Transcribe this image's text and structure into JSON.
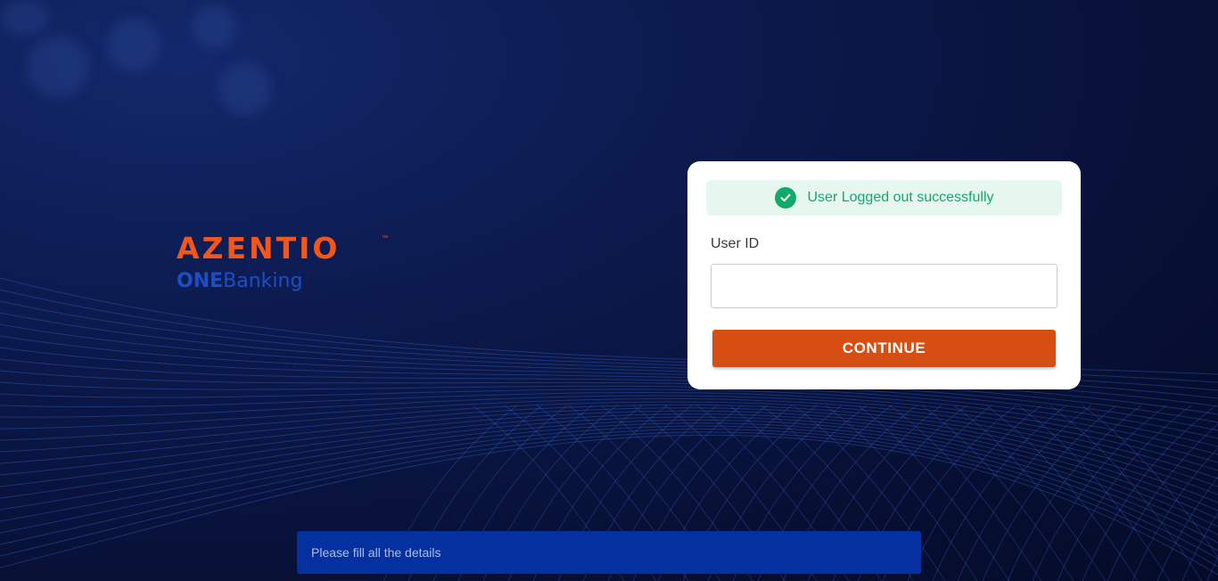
{
  "brand": {
    "logo_text": "AZENTIO",
    "tm": "™",
    "product_bold": "ONE",
    "product_light": "Banking"
  },
  "login": {
    "alert": {
      "icon": "check-circle-icon",
      "message": "User Logged out successfully",
      "color": "#14a86b"
    },
    "user_id_label": "User ID",
    "user_id_value": "",
    "continue_label": "CONTINUE"
  },
  "toast": {
    "message": "Please fill all the details"
  },
  "colors": {
    "brand_orange": "#f2561d",
    "button": "#d64e11",
    "toast_bg": "#0531a0",
    "brand_blue": "#1d4fc4"
  }
}
